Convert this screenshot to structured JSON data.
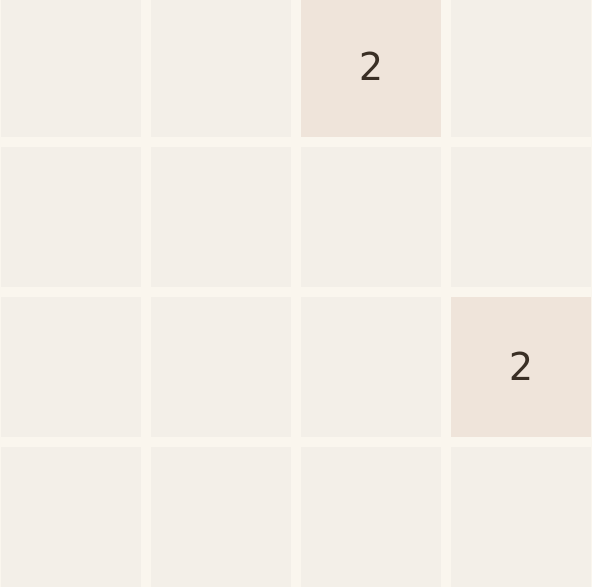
{
  "board": {
    "rows": [
      [
        "",
        "",
        "2",
        ""
      ],
      [
        "",
        "",
        "",
        ""
      ],
      [
        "",
        "",
        "",
        "2"
      ],
      [
        "",
        "",
        "",
        ""
      ]
    ]
  }
}
